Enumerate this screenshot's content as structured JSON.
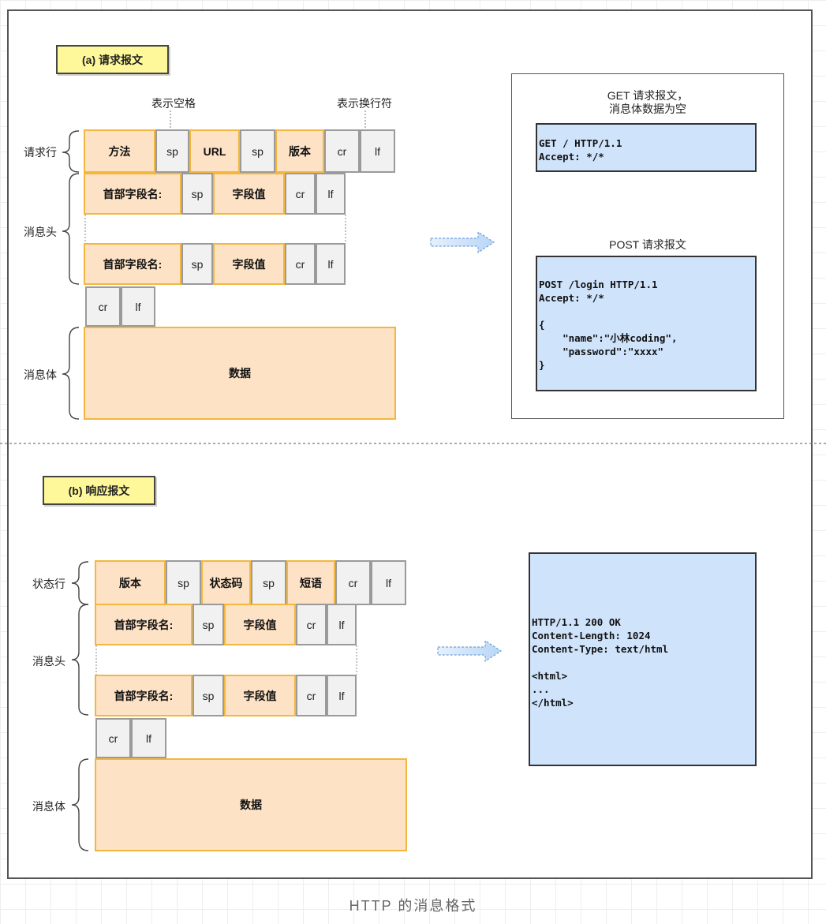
{
  "caption": "HTTP 的消息格式",
  "request": {
    "tag": "(a) 请求报文",
    "callout_space": "表示空格",
    "callout_newline": "表示换行符",
    "labels": {
      "request_line": "请求行",
      "headers": "消息头",
      "body": "消息体"
    },
    "request_line": [
      "方法",
      "sp",
      "URL",
      "sp",
      "版本",
      "cr",
      "lf"
    ],
    "header_row": [
      "首部字段名:",
      "sp",
      "字段值",
      "cr",
      "lf"
    ],
    "crlf": [
      "cr",
      "lf"
    ],
    "body": "数据",
    "get_title": "GET 请求报文，\n消息体数据为空",
    "get_content": "GET / HTTP/1.1\nAccept: */*",
    "post_title": "POST 请求报文",
    "post_content": "POST /login HTTP/1.1\nAccept: */*\n\n{\n    \"name\":\"小林coding\",\n    \"password\":\"xxxx\"\n}"
  },
  "response": {
    "tag": "(b) 响应报文",
    "labels": {
      "status_line": "状态行",
      "headers": "消息头",
      "body": "消息体"
    },
    "status_line": [
      "版本",
      "sp",
      "状态码",
      "sp",
      "短语",
      "cr",
      "lf"
    ],
    "header_row": [
      "首部字段名:",
      "sp",
      "字段值",
      "cr",
      "lf"
    ],
    "crlf": [
      "cr",
      "lf"
    ],
    "body": "数据",
    "example_content": "HTTP/1.1 200 OK\nContent-Length: 1024\nContent-Type: text/html\n\n<html>\n...\n</html>"
  }
}
